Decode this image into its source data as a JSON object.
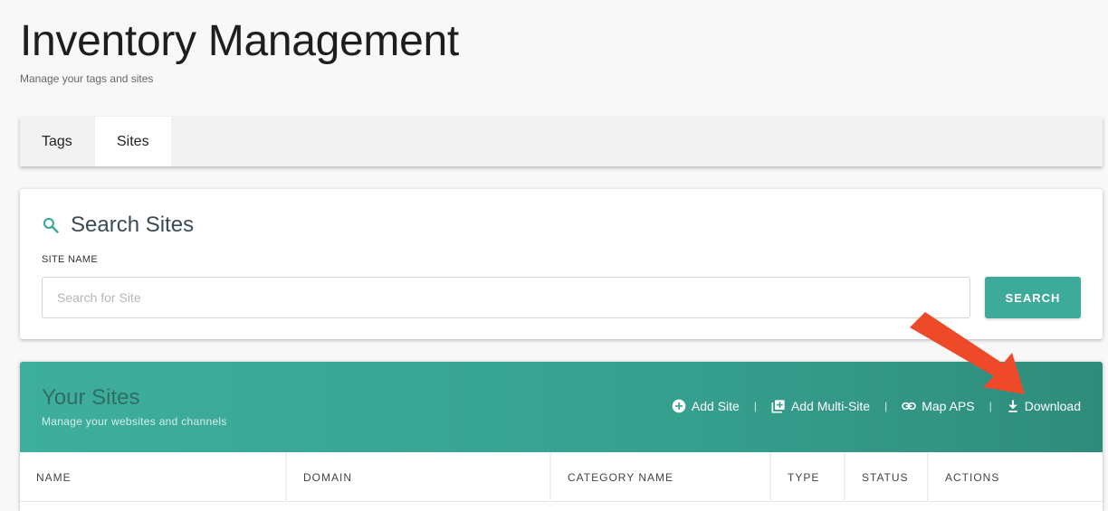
{
  "page": {
    "title": "Inventory Management",
    "subtitle": "Manage your tags and sites"
  },
  "tabs": [
    {
      "label": "Tags",
      "active": false
    },
    {
      "label": "Sites",
      "active": true
    }
  ],
  "search": {
    "heading": "Search Sites",
    "field_label": "SITE NAME",
    "placeholder": "Search for Site",
    "value": "",
    "button_label": "SEARCH"
  },
  "sites": {
    "title": "Your Sites",
    "subtitle": "Manage your websites and channels",
    "actions": [
      {
        "label": "Add Site",
        "icon": "plus-circle-icon"
      },
      {
        "label": "Add Multi-Site",
        "icon": "library-add-icon"
      },
      {
        "label": "Map APS",
        "icon": "link-icon"
      },
      {
        "label": "Download",
        "icon": "download-icon"
      }
    ],
    "separator": "|",
    "columns": [
      "NAME",
      "DOMAIN",
      "CATEGORY NAME",
      "TYPE",
      "STATUS",
      "ACTIONS"
    ]
  },
  "colors": {
    "accent": "#3daa9a",
    "annotation_arrow": "#ee4a2a"
  }
}
